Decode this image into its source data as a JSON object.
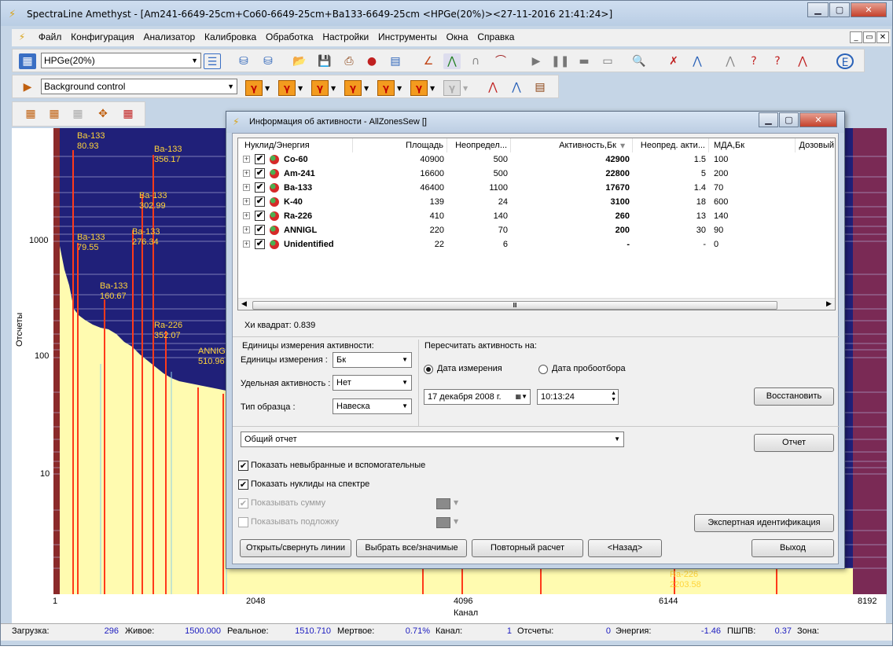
{
  "window": {
    "title": "SpectraLine Amethyst - [Am241-6649-25cm+Co60-6649-25cm+Ba133-6649-25cm <HPGe(20%)><27-11-2016 21:41:24>]",
    "min_glyph": "▁",
    "max_glyph": "▢",
    "close_glyph": "✕"
  },
  "menu": {
    "items": [
      "Файл",
      "Конфигурация",
      "Анализатор",
      "Калибровка",
      "Обработка",
      "Настройки",
      "Инструменты",
      "Окна",
      "Справка"
    ],
    "mdi_min": "_",
    "mdi_restore": "▭",
    "mdi_close": "✕"
  },
  "toolbar": {
    "detector_value": "HPGe(20%)",
    "mode_value": "Background control"
  },
  "spectrum": {
    "y_axis_label": "Отсчеты",
    "x_axis_label": "Канал",
    "y_ticks": [
      "1000",
      "100",
      "10"
    ],
    "x_ticks": [
      "1",
      "2048",
      "4096",
      "6144",
      "8192"
    ],
    "peak_labels": [
      {
        "name": "Ba-133",
        "energy": "80.93"
      },
      {
        "name": "Ba-133",
        "energy": "356.17"
      },
      {
        "name": "Ba-133",
        "energy": "302.99"
      },
      {
        "name": "Ba-133",
        "energy": "79.55"
      },
      {
        "name": "Ba-133",
        "energy": "276.34"
      },
      {
        "name": "Ba-133",
        "energy": "160.67"
      },
      {
        "name": "Ra-226",
        "energy": "352.07"
      },
      {
        "name": "ANNIGL",
        "energy": "510.96"
      },
      {
        "name": "Ra-226",
        "energy": "2203.58"
      }
    ]
  },
  "status": {
    "load_label": "Загрузка:",
    "load_value": "296",
    "live_label": "Живое:",
    "live_value": "1500.000",
    "real_label": "Реальное:",
    "real_value": "1510.710",
    "dead_label": "Мертвое:",
    "dead_value": "0.71%",
    "channel_label": "Канал:",
    "channel_value": "1",
    "counts_label": "Отсчеты:",
    "counts_value": "0",
    "energy_label": "Энергия:",
    "energy_value": "-1.46",
    "fwhm_label": "ПШПВ:",
    "fwhm_value": "0.37",
    "zone_label": "Зона:"
  },
  "dialog": {
    "title": "Информация об активности - AllZonesSew []",
    "columns": [
      "Нуклид/Энергия",
      "Площадь",
      "Неопредел...",
      "Активность,Бк",
      "Неопред. акти...",
      "МДА,Бк",
      "Дозовый"
    ],
    "rows": [
      {
        "nuclide": "Co-60",
        "area": "40900",
        "unc": "500",
        "activity": "42900",
        "act_unc": "1.5",
        "mda": "100"
      },
      {
        "nuclide": "Am-241",
        "area": "16600",
        "unc": "500",
        "activity": "22800",
        "act_unc": "5",
        "mda": "200"
      },
      {
        "nuclide": "Ba-133",
        "area": "46400",
        "unc": "1100",
        "activity": "17670",
        "act_unc": "1.4",
        "mda": "70"
      },
      {
        "nuclide": "K-40",
        "area": "139",
        "unc": "24",
        "activity": "3100",
        "act_unc": "18",
        "mda": "600"
      },
      {
        "nuclide": "Ra-226",
        "area": "410",
        "unc": "140",
        "activity": "260",
        "act_unc": "13",
        "mda": "140"
      },
      {
        "nuclide": "ANNIGL",
        "area": "220",
        "unc": "70",
        "activity": "200",
        "act_unc": "30",
        "mda": "90"
      },
      {
        "nuclide": "Unidentified",
        "area": "22",
        "unc": "6",
        "activity": "-",
        "act_unc": "-",
        "mda": "0"
      }
    ],
    "chi_square": "Хи квадрат: 0.839",
    "units_group": "Единицы измерения активности:",
    "units_label": "Единицы измерения :",
    "units_value": "Бк",
    "specific_label": "Удельная активность :",
    "specific_value": "Нет",
    "sample_label": "Тип образца :",
    "sample_value": "Навеска",
    "recalc_group": "Пересчитать активность на:",
    "radio_measure": "Дата измерения",
    "radio_sampling": "Дата пробоотбора",
    "date_value": "17  декабря  2008 г.",
    "time_value": "10:13:24",
    "restore_btn": "Восстановить",
    "report_value": "Общий отчет",
    "report_btn": "Отчет",
    "cb_show_unselected": "Показать невыбранные и вспомогательные",
    "cb_show_nuclides": "Показать нуклиды на спектре",
    "cb_show_sum": "Показывать сумму",
    "cb_show_substrate": "Показывать подложку",
    "expert_btn": "Экспертная идентификация",
    "btn_toggle_lines": "Открыть/свернуть линии",
    "btn_select_all": "Выбрать все/значимые",
    "btn_recalc": "Повторный расчет",
    "btn_back": "<Назад>",
    "btn_exit": "Выход"
  }
}
